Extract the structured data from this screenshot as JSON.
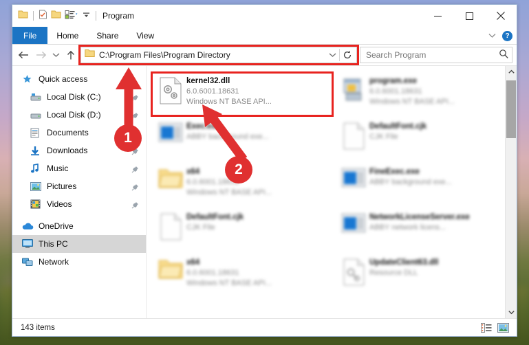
{
  "window": {
    "title": "Program",
    "quick_access": [
      "folder-icon",
      "properties-icon",
      "new-folder-icon",
      "view-options-icon",
      "customize-icon"
    ],
    "controls": {
      "minimize": "—",
      "maximize": "□",
      "close": "✕"
    }
  },
  "ribbon": {
    "tabs": [
      {
        "label": "File",
        "active": true
      },
      {
        "label": "Home",
        "active": false
      },
      {
        "label": "Share",
        "active": false
      },
      {
        "label": "View",
        "active": false
      }
    ],
    "help_label": "?"
  },
  "address": {
    "path": "C:\\Program Files\\Program Directory",
    "highlighted": true,
    "back_title": "Back",
    "forward_title": "Forward",
    "recent_title": "Recent locations",
    "up_title": "Up one level",
    "dropdown_title": "Previous locations",
    "refresh_title": "Refresh"
  },
  "search": {
    "placeholder": "Search Program",
    "value": ""
  },
  "sidebar": {
    "items": [
      {
        "label": "Quick access",
        "icon": "star-icon",
        "indent": false,
        "pinned": false,
        "selected": false
      },
      {
        "label": "Local Disk (C:)",
        "icon": "drive-icon",
        "indent": true,
        "pinned": true,
        "selected": false
      },
      {
        "label": "Local Disk (D:)",
        "icon": "drive-icon",
        "indent": true,
        "pinned": true,
        "selected": false
      },
      {
        "label": "Documents",
        "icon": "documents-icon",
        "indent": true,
        "pinned": true,
        "selected": false
      },
      {
        "label": "Downloads",
        "icon": "downloads-icon",
        "indent": true,
        "pinned": true,
        "selected": false
      },
      {
        "label": "Music",
        "icon": "music-icon",
        "indent": true,
        "pinned": true,
        "selected": false
      },
      {
        "label": "Pictures",
        "icon": "pictures-icon",
        "indent": true,
        "pinned": true,
        "selected": false
      },
      {
        "label": "Videos",
        "icon": "videos-icon",
        "indent": true,
        "pinned": true,
        "selected": false
      },
      {
        "label": "OneDrive",
        "icon": "cloud-icon",
        "indent": false,
        "pinned": false,
        "selected": false
      },
      {
        "label": "This PC",
        "icon": "monitor-icon",
        "indent": false,
        "pinned": false,
        "selected": true
      },
      {
        "label": "Network",
        "icon": "network-icon",
        "indent": false,
        "pinned": false,
        "selected": false
      }
    ]
  },
  "files": [
    {
      "name": "kernel32.dll",
      "line2": "6.0.6001.18631",
      "line3": "Windows NT BASE API...",
      "icon": "dll-gear-icon",
      "blurred": false,
      "highlighted": true
    },
    {
      "name": "program.exe",
      "line2": "6.0.6001.18631",
      "line3": "Windows NT BASE API...",
      "icon": "exe-icon",
      "blurred": true,
      "highlighted": false
    },
    {
      "name": "Exec.exe",
      "line2": "ABBY background exe...",
      "line3": "",
      "icon": "app-blue-icon",
      "blurred": true,
      "highlighted": false
    },
    {
      "name": "DefaultFont.cjk",
      "line2": "CJK File",
      "line3": "",
      "icon": "blank-doc-icon",
      "blurred": true,
      "highlighted": false
    },
    {
      "name": "x64",
      "line2": "6.0.6001.18631",
      "line3": "Windows NT BASE API...",
      "icon": "folder-icon",
      "blurred": true,
      "highlighted": false
    },
    {
      "name": "FineExec.exe",
      "line2": "ABBY background exe...",
      "line3": "",
      "icon": "app-blue-icon",
      "blurred": true,
      "highlighted": false
    },
    {
      "name": "DefaultFont.cjk",
      "line2": "CJK File",
      "line3": "",
      "icon": "blank-doc-icon",
      "blurred": true,
      "highlighted": false
    },
    {
      "name": "NetworkLicenseServer.exe",
      "line2": "ABBY network licens...",
      "line3": "",
      "icon": "app-blue-icon",
      "blurred": true,
      "highlighted": false
    },
    {
      "name": "x64",
      "line2": "6.0.6001.18631",
      "line3": "Windows NT BASE API...",
      "icon": "folder-icon",
      "blurred": true,
      "highlighted": false
    },
    {
      "name": "UpdateClient63.dll",
      "line2": "Resource DLL",
      "line3": "",
      "icon": "dll-search-icon",
      "blurred": true,
      "highlighted": false
    }
  ],
  "status": {
    "item_count": "143 items",
    "view_details_title": "Details view",
    "view_large_title": "Large icons view"
  },
  "annotations": [
    {
      "number": "1",
      "target": "address-bar"
    },
    {
      "number": "2",
      "target": "kernel32-file-tile"
    }
  ],
  "colors": {
    "accent": "#1b74c4",
    "annotation_red": "#e03030",
    "highlight_red": "#e8231f",
    "selection_gray": "#d6d6d6"
  }
}
